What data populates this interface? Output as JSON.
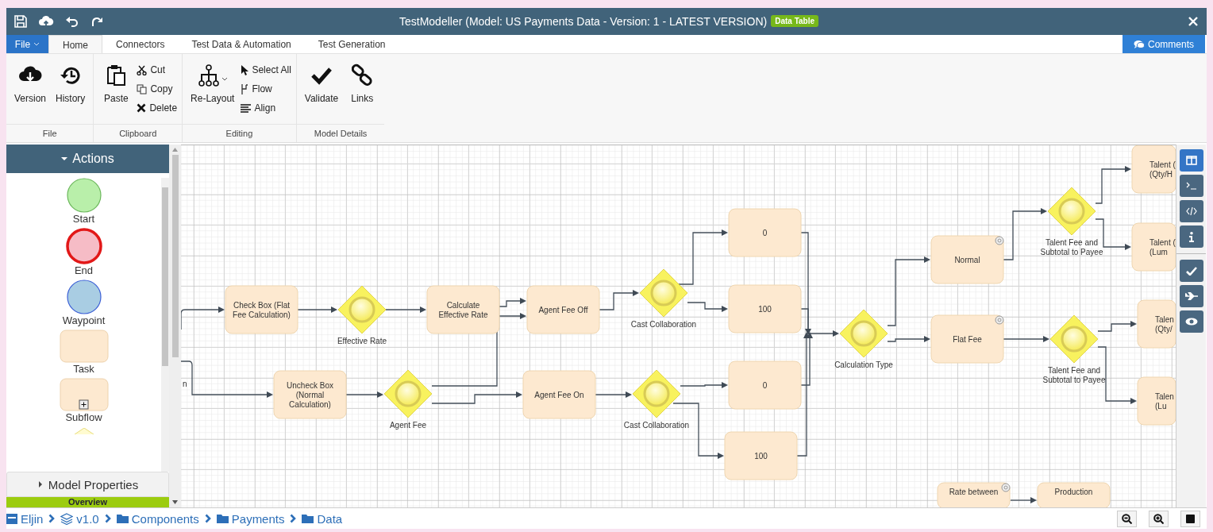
{
  "window": {
    "title": "TestModeller (Model: US Payments Data - Version: 1 - LATEST VERSION)",
    "badge": "Data Table"
  },
  "file_button": "File",
  "tabs": [
    {
      "label": "Home",
      "selected": true
    },
    {
      "label": "Connectors",
      "selected": false
    },
    {
      "label": "Test Data & Automation",
      "selected": false
    },
    {
      "label": "Test Generation",
      "selected": false
    }
  ],
  "comments_button": "Comments",
  "ribbon": [
    {
      "label": "File",
      "items": [
        {
          "label": "Version",
          "kind": "large"
        },
        {
          "label": "History",
          "kind": "large"
        }
      ]
    },
    {
      "label": "Clipboard",
      "items": [
        {
          "label": "Paste",
          "kind": "large"
        },
        {
          "label": "Cut",
          "kind": "small"
        },
        {
          "label": "Copy",
          "kind": "small"
        },
        {
          "label": "Delete",
          "kind": "small"
        }
      ]
    },
    {
      "label": "Editing",
      "items": [
        {
          "label": "Re-Layout",
          "kind": "large"
        },
        {
          "label": "Select All",
          "kind": "small"
        },
        {
          "label": "Flow",
          "kind": "small"
        },
        {
          "label": "Align",
          "kind": "small"
        }
      ]
    },
    {
      "label": "Model Details",
      "items": [
        {
          "label": "Validate",
          "kind": "large"
        },
        {
          "label": "Links",
          "kind": "large"
        }
      ]
    }
  ],
  "sidebar": {
    "title": "Actions",
    "expanded": true,
    "items": [
      {
        "label": "Start",
        "kind": "start"
      },
      {
        "label": "End",
        "kind": "end"
      },
      {
        "label": "Waypoint",
        "kind": "waypoint"
      },
      {
        "label": "Task",
        "kind": "task"
      },
      {
        "label": "Subflow",
        "kind": "subflow"
      }
    ]
  },
  "model_properties": {
    "title": "Model Properties",
    "expanded": false
  },
  "overview": "Overview",
  "diagram": {
    "nodes": [
      {
        "kind": "fragment",
        "lines": [
          "n"
        ]
      },
      {
        "kind": "task",
        "lines": [
          "Check Box (Flat",
          "Fee Calculation)"
        ]
      },
      {
        "kind": "gateway",
        "lines": [
          "Effective Rate"
        ]
      },
      {
        "kind": "task",
        "lines": [
          "Calculate",
          "Effective Rate"
        ]
      },
      {
        "kind": "task",
        "lines": [
          "Agent Fee Off"
        ]
      },
      {
        "kind": "gateway",
        "lines": [
          "Cast Collaboration"
        ]
      },
      {
        "kind": "task",
        "lines": [
          "Uncheck Box",
          "(Normal",
          "Calculation)"
        ]
      },
      {
        "kind": "gateway",
        "lines": [
          "Agent Fee"
        ]
      },
      {
        "kind": "task",
        "lines": [
          "Agent Fee On"
        ]
      },
      {
        "kind": "gateway",
        "lines": [
          "Cast Collaboration"
        ]
      },
      {
        "kind": "task",
        "lines": [
          "0"
        ]
      },
      {
        "kind": "task",
        "lines": [
          "100"
        ]
      },
      {
        "kind": "task",
        "lines": [
          "0"
        ]
      },
      {
        "kind": "task",
        "lines": [
          "100"
        ]
      },
      {
        "kind": "gateway",
        "lines": [
          "Calculation Type"
        ]
      },
      {
        "kind": "linked_task",
        "lines": [
          "Normal"
        ]
      },
      {
        "kind": "linked_task",
        "lines": [
          "Flat Fee"
        ]
      },
      {
        "kind": "gateway",
        "lines": [
          "Talent Fee and",
          "Subtotal to Payee"
        ]
      },
      {
        "kind": "gateway",
        "lines": [
          "Talent Fee and",
          "Subtotal to Payee"
        ]
      },
      {
        "kind": "task",
        "lines": [
          "Talent (",
          "(Qty/H"
        ]
      },
      {
        "kind": "task",
        "lines": [
          "Talent (",
          "(Lum"
        ]
      },
      {
        "kind": "task",
        "lines": [
          "Talen",
          "(Qty/"
        ]
      },
      {
        "kind": "task",
        "lines": [
          "Talen",
          "(Lu"
        ]
      },
      {
        "kind": "linked_task",
        "lines": [
          "Rate between"
        ]
      },
      {
        "kind": "task",
        "lines": [
          "Production"
        ]
      }
    ]
  },
  "side_tools": [
    {
      "selected": true
    },
    {
      "selected": false
    },
    {
      "selected": false
    },
    {
      "selected": false
    },
    {
      "selected": false
    },
    {
      "selected": false
    },
    {
      "selected": false
    }
  ],
  "breadcrumb": [
    {
      "label": "Eljin",
      "kind": "project"
    },
    {
      "label": "v1.0",
      "kind": "version"
    },
    {
      "label": "Components",
      "kind": "folder"
    },
    {
      "label": "Payments",
      "kind": "folder"
    },
    {
      "label": "Data",
      "kind": "folder"
    }
  ]
}
